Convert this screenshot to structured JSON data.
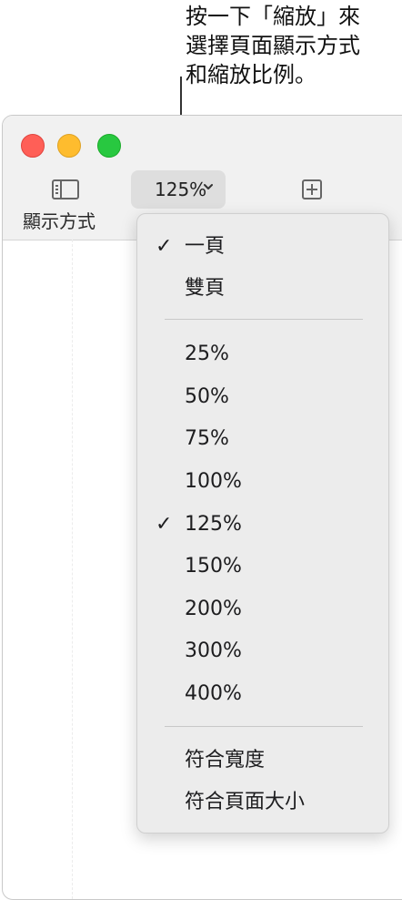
{
  "callout": {
    "lines": [
      "按一下「縮放」來",
      "選擇頁面顯示方式",
      "和縮放比例。"
    ]
  },
  "window": {
    "traffic_lights": [
      "close",
      "minimize",
      "zoom"
    ],
    "toolbar": {
      "view_label": "顯示方式",
      "zoom_value": "125%"
    }
  },
  "menu": {
    "items": [
      {
        "label": "一頁",
        "checked": true
      },
      {
        "label": "雙頁",
        "checked": false
      },
      {
        "label": "25%",
        "checked": false
      },
      {
        "label": "50%",
        "checked": false
      },
      {
        "label": "75%",
        "checked": false
      },
      {
        "label": "100%",
        "checked": false
      },
      {
        "label": "125%",
        "checked": true
      },
      {
        "label": "150%",
        "checked": false
      },
      {
        "label": "200%",
        "checked": false
      },
      {
        "label": "300%",
        "checked": false
      },
      {
        "label": "400%",
        "checked": false
      },
      {
        "label": "符合寬度",
        "checked": false
      },
      {
        "label": "符合頁面大小",
        "checked": false
      }
    ],
    "check_glyph": "✓"
  },
  "colors": {
    "close": "#ff5f57",
    "minimize": "#febc2e",
    "zoom": "#28c840",
    "menu_bg": "#ececec"
  }
}
